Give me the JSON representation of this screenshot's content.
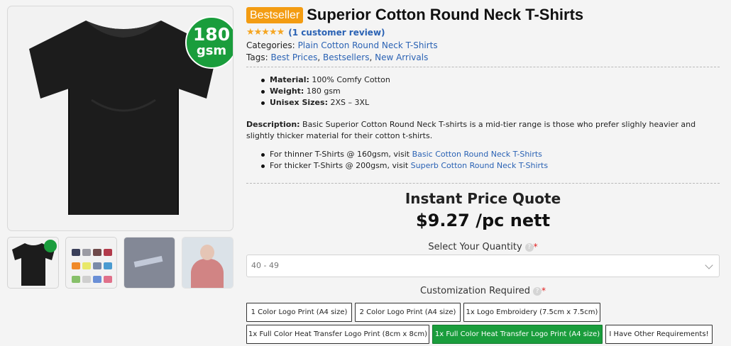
{
  "gallery": {
    "main_badge": {
      "value": "180",
      "unit": "gsm"
    },
    "thumbnails": [
      "black-tshirt-thumb",
      "color-chart-thumb",
      "print-sample-thumb",
      "model-photo-thumb"
    ]
  },
  "product": {
    "badge": "Bestseller",
    "title": "Superior Cotton Round Neck T-Shirts",
    "stars": "★★★★★",
    "review_link": "(1 customer review)",
    "categories_label": "Categories:",
    "categories": [
      "Plain Cotton Round Neck T-Shirts"
    ],
    "tags_label": "Tags:",
    "tags": [
      "Best Prices",
      "Bestsellers",
      "New Arrivals"
    ],
    "tag_separator": ", ",
    "specs": [
      {
        "label": "Material:",
        "value": " 100% Comfy Cotton"
      },
      {
        "label": "Weight:",
        "value": " 180 gsm"
      },
      {
        "label": "Unisex Sizes:",
        "value": " 2XS – 3XL"
      }
    ],
    "description_label": "Description:",
    "description": " Basic Superior Cotton Round Neck T-shirts is a mid-tier range is those who prefer slighly heavier and slightly thicker material for their cotton t-shirts.",
    "links": [
      {
        "prefix": "For thinner T-Shirts @ 160gsm, visit ",
        "link": "Basic Cotton Round Neck T-Shirts"
      },
      {
        "prefix": "For thicker T-Shirts @ 200gsm, visit ",
        "link": "Superb Cotton Round Neck T-Shirts"
      }
    ]
  },
  "pricing": {
    "title": "Instant Price Quote",
    "price": "$9.27 /pc nett",
    "quantity_label": "Select Your Quantity",
    "help_icon": "?",
    "required_mark": "*",
    "quantity_value": "40 - 49",
    "customization_label": "Customization Required",
    "options": [
      "1 Color Logo Print (A4 size)",
      "2 Color Logo Print (A4 size)",
      "1x Logo Embroidery (7.5cm x 7.5cm)",
      "1x Full Color Heat Transfer Logo Print (8cm x 8cm)",
      "1x Full Color Heat Transfer Logo Print (A4 size)",
      "I Have Other Requirements!"
    ],
    "selected_option": "1x Full Color Heat Transfer Logo Print (A4 size)"
  },
  "colors": {
    "brand_green": "#1a9d3c",
    "badge_orange": "#f39c12",
    "link_blue": "#2a62b4",
    "star_gold": "#f5a623"
  }
}
